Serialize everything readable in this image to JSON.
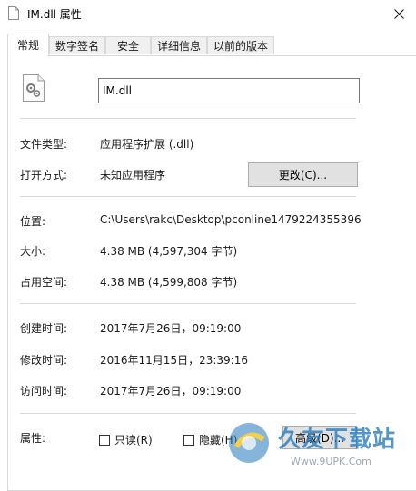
{
  "window": {
    "title": "IM.dll 属性"
  },
  "tabs": [
    {
      "label": "常规",
      "active": true
    },
    {
      "label": "数字签名",
      "active": false
    },
    {
      "label": "安全",
      "active": false
    },
    {
      "label": "详细信息",
      "active": false
    },
    {
      "label": "以前的版本",
      "active": false
    }
  ],
  "file": {
    "name": "IM.dll"
  },
  "properties": {
    "type_label": "文件类型:",
    "type_value": "应用程序扩展 (.dll)",
    "opens_with_label": "打开方式:",
    "opens_with_value": "未知应用程序",
    "change_button": "更改(C)...",
    "location_label": "位置:",
    "location_value": "C:\\Users\\rakc\\Desktop\\pconline1479224355396",
    "size_label": "大小:",
    "size_value": "4.38 MB (4,597,304 字节)",
    "size_on_disk_label": "占用空间:",
    "size_on_disk_value": "4.38 MB (4,599,808 字节)",
    "created_label": "创建时间:",
    "created_value": "2017年7月26日，09:19:00",
    "modified_label": "修改时间:",
    "modified_value": "2016年11月15日，23:39:16",
    "accessed_label": "访问时间:",
    "accessed_value": "2017年7月26日，09:19:00",
    "attributes_label": "属性:",
    "readonly_label": "只读(R)",
    "hidden_label": "隐藏(H)",
    "advanced_button": "高级(D)..."
  },
  "watermark": {
    "text": "久友下载站",
    "url": "Www.9UPK.Com"
  },
  "colors": {
    "border": "#d9d9d9",
    "button_bg": "#e1e1e1",
    "watermark_blue": "#2378be"
  }
}
